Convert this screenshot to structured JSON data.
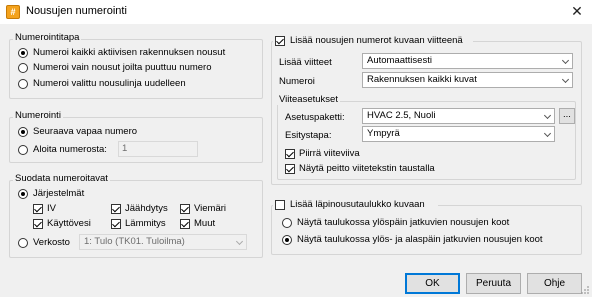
{
  "window": {
    "title": "Nousujen numerointi",
    "app_icon": "app-icon",
    "close_icon": "close-icon"
  },
  "numbering_mode": {
    "legend": "Numerointitapa",
    "options": [
      {
        "label": "Numeroi kaikki aktiivisen rakennuksen nousut",
        "selected": true
      },
      {
        "label": "Numeroi vain nousut joilta puuttuu numero",
        "selected": false
      },
      {
        "label": "Numeroi valittu nousulinja uudelleen",
        "selected": false
      }
    ]
  },
  "numbering": {
    "legend": "Numerointi",
    "options": [
      {
        "label": "Seuraava vapaa numero",
        "selected": true
      },
      {
        "label": "Aloita numerosta:",
        "selected": false
      }
    ],
    "start_value": "1"
  },
  "filter": {
    "legend": "Suodata numeroitavat",
    "systems_label": "Järjestelmät",
    "systems_selected": true,
    "systems": [
      {
        "label": "IV",
        "checked": true
      },
      {
        "label": "Jäähdytys",
        "checked": true
      },
      {
        "label": "Viemäri",
        "checked": true
      },
      {
        "label": "Käyttövesi",
        "checked": true
      },
      {
        "label": "Lämmitys",
        "checked": true
      },
      {
        "label": "Muut",
        "checked": true
      }
    ],
    "network_label": "Verkosto",
    "network_selected": false,
    "network_value": "1: Tulo (TK01. Tuloilma)"
  },
  "reference": {
    "checkbox_label": "Lisää nousujen numerot kuvaan viitteenä",
    "checked": true,
    "add_refs_label": "Lisää viitteet",
    "add_refs_value": "Automaattisesti",
    "numbering_label": "Numeroi",
    "numbering_value": "Rakennuksen kaikki kuvat",
    "settings_legend": "Viiteasetukset",
    "package_label": "Asetuspaketti:",
    "package_value": "HVAC 2.5, Nuoli",
    "browse_label": "...",
    "style_label": "Esitystapa:",
    "style_value": "Ympyrä",
    "leader_label": "Piirrä viiteviiva",
    "leader_checked": true,
    "mask_label": "Näytä peitto viitetekstin taustalla",
    "mask_checked": true
  },
  "riser_table": {
    "checkbox_label": "Lisää läpinousutaulukko kuvaan",
    "checked": false,
    "options": [
      {
        "label": "Näytä taulukossa ylöspäin jatkuvien nousujen koot",
        "selected": false
      },
      {
        "label": "Näytä taulukossa ylös- ja alaspäin jatkuvien nousujen koot",
        "selected": true
      }
    ]
  },
  "buttons": {
    "ok": "OK",
    "cancel": "Peruuta",
    "help": "Ohje"
  }
}
